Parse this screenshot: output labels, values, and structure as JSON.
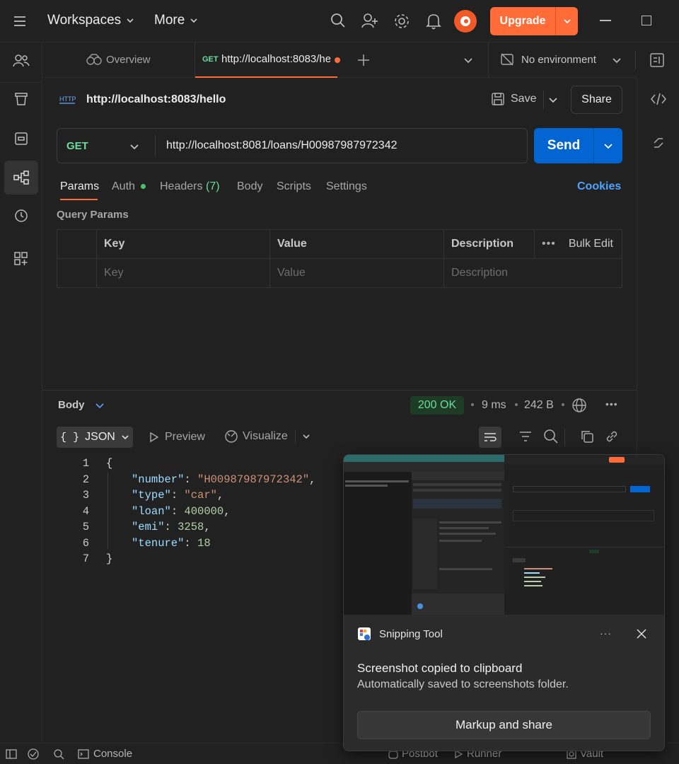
{
  "topbar": {
    "workspaces_label": "Workspaces",
    "more_label": "More",
    "upgrade_label": "Upgrade"
  },
  "tabs": {
    "overview_label": "Overview",
    "active_method": "GET",
    "active_url": "http://localhost:8083/he",
    "environment_label": "No environment"
  },
  "request": {
    "name": "http://localhost:8083/hello",
    "save_label": "Save",
    "share_label": "Share",
    "method": "GET",
    "url": "http://localhost:8081/loans/H00987987972342",
    "send_label": "Send",
    "tabs": {
      "params": "Params",
      "auth": "Auth",
      "headers": "Headers",
      "headers_count": "(7)",
      "body": "Body",
      "scripts": "Scripts",
      "settings": "Settings"
    },
    "cookies_label": "Cookies",
    "query_params_title": "Query Params",
    "table": {
      "headers": [
        "Key",
        "Value",
        "Description"
      ],
      "bulk_edit": "Bulk Edit",
      "placeholders": [
        "Key",
        "Value",
        "Description"
      ]
    }
  },
  "response": {
    "body_label": "Body",
    "status": "200 OK",
    "time": "9 ms",
    "size": "242 B",
    "format_label": "JSON",
    "preview_label": "Preview",
    "visualize_label": "Visualize",
    "line_numbers": [
      "1",
      "2",
      "3",
      "4",
      "5",
      "6",
      "7"
    ],
    "json": {
      "number": "\"H00987987972342\"",
      "type": "\"car\"",
      "loan": "400000",
      "emi": "3258",
      "tenure": "18"
    }
  },
  "statusbar": {
    "console_label": "Console",
    "postbot_label": "Postbot",
    "runner_label": "Runner",
    "vault_label": "Vault"
  },
  "toast": {
    "app_name": "Snipping Tool",
    "title": "Screenshot copied to clipboard",
    "subtitle": "Automatically saved to screenshots folder.",
    "button_label": "Markup and share"
  },
  "colors": {
    "accent_orange": "#ff6c37",
    "send_blue": "#0265d2",
    "link_blue": "#4fa3ff",
    "get_green": "#6bdd9a",
    "status_green": "#6bdd9a"
  }
}
